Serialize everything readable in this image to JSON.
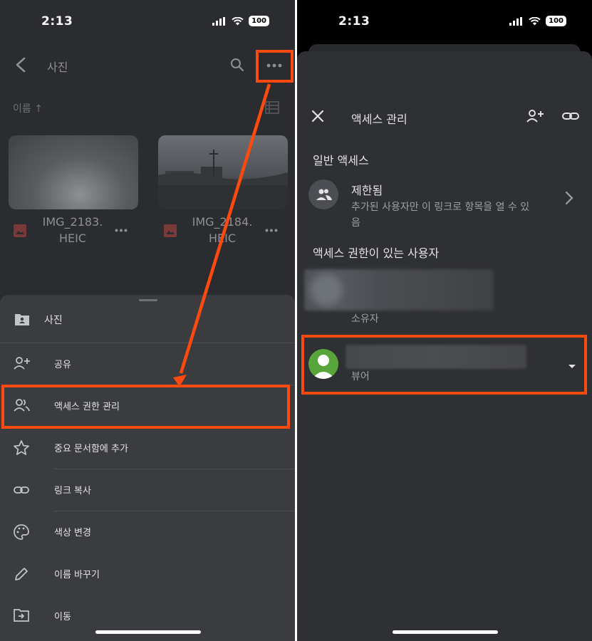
{
  "colors": {
    "background_dark": "#2b2c30",
    "sheet_bg": "#3b3c40",
    "highlight": "#ff4a0f",
    "viewer_avatar": "#58a63b"
  },
  "left": {
    "status_bar": {
      "time": "2:13",
      "battery": "100"
    },
    "app_bar": {
      "title": "사진"
    },
    "sort_label": "이름 ↑",
    "files": [
      {
        "name": "IMG_2183.\nHEIC"
      },
      {
        "name": "IMG_2184.\nHEIC"
      }
    ],
    "sheet": {
      "folder_name": "사진",
      "items": [
        {
          "label": "공유",
          "icon": "add-person-icon"
        },
        {
          "label": "액세스 권한 관리",
          "icon": "people-icon"
        },
        {
          "label": "중요 문서함에 추가",
          "icon": "star-icon"
        },
        {
          "label": "링크 복사",
          "icon": "link-icon"
        },
        {
          "label": "색상 변경",
          "icon": "palette-icon"
        },
        {
          "label": "이름 바꾸기",
          "icon": "pencil-icon"
        },
        {
          "label": "이동",
          "icon": "move-icon"
        }
      ]
    }
  },
  "right": {
    "status_bar": {
      "time": "2:13",
      "battery": "100"
    },
    "manage_access": {
      "title": "액세스 관리",
      "general_access_title": "일반 액세스",
      "restricted_label": "제한됨",
      "restricted_desc": "추가된 사용자만 이 링크로 항목을 열 수 있음",
      "people_title": "액세스 권한이 있는 사용자",
      "owner_role": "소유자",
      "viewer_role": "뷰어"
    }
  }
}
